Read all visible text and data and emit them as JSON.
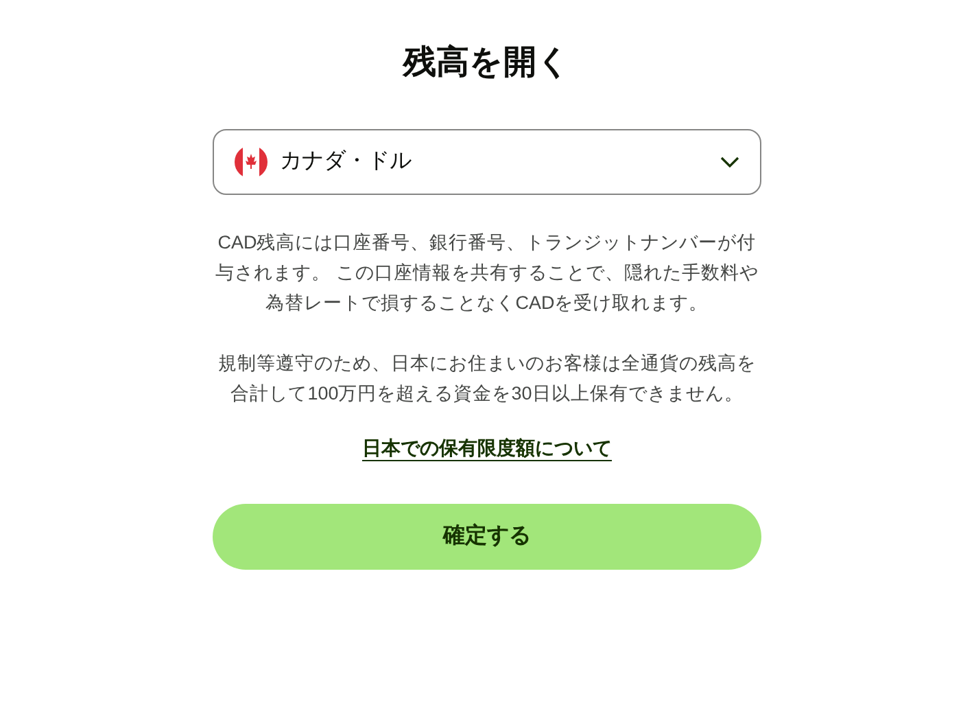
{
  "title": "残高を開く",
  "currency_select": {
    "value": "カナダ・ドル"
  },
  "description": [
    "CAD残高には口座番号、銀行番号、トランジットナンバーが付",
    "与されます。 この口座情報を共有することで、隠れた手数料や",
    "為替レートで損することなくCADを受け取れます。"
  ],
  "notice": [
    "規制等遵守のため、日本にお住まいのお客様は全通貨の残高を",
    "合計して100万円を超える資金を30日以上保有できません。"
  ],
  "link": "日本での保有限度額について",
  "confirm_button": "確定する"
}
